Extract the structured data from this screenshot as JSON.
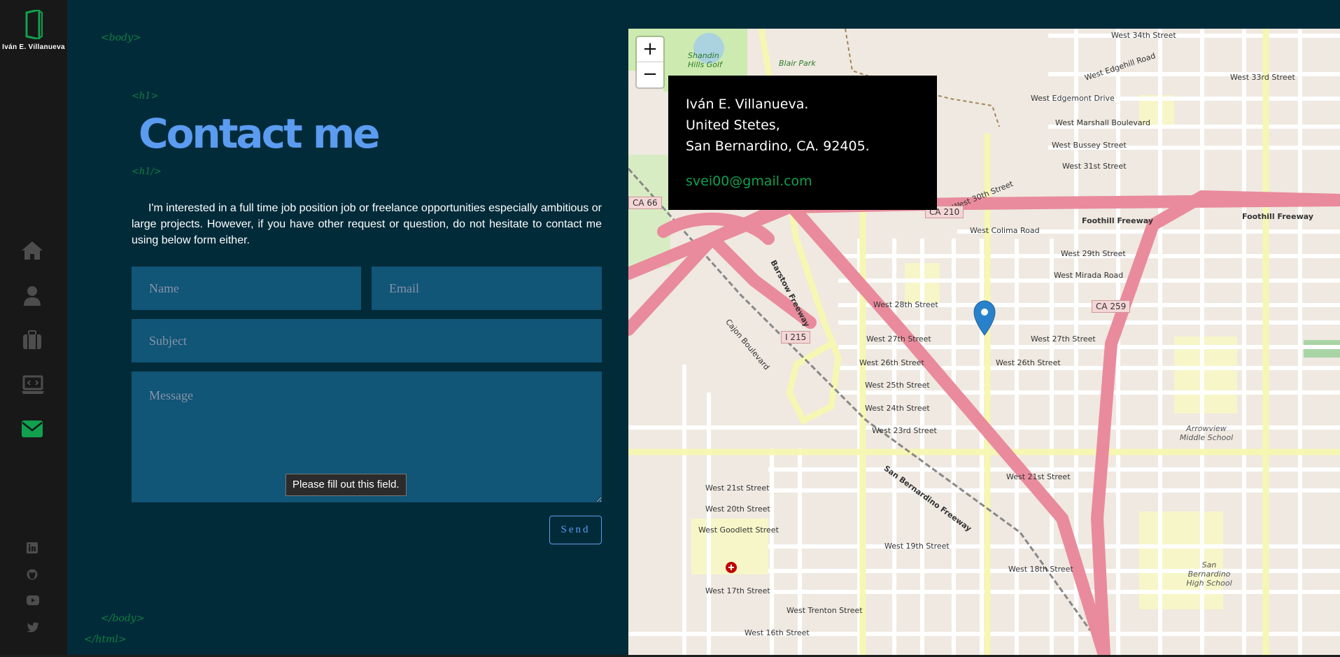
{
  "app": {
    "owner_name": "Iván E. Villanueva"
  },
  "tags": {
    "body_open": "<body>",
    "h1_open": "<h1>",
    "h1_close": "<h1/>",
    "body_close": "</body>",
    "html_close": "</html>"
  },
  "sidebar": {
    "nav_items": [
      {
        "name": "home",
        "icon": "home-icon",
        "active": false
      },
      {
        "name": "about",
        "icon": "user-icon",
        "active": false
      },
      {
        "name": "skills",
        "icon": "briefcase-icon",
        "active": false
      },
      {
        "name": "portfolio",
        "icon": "laptop-code-icon",
        "active": false
      },
      {
        "name": "contact",
        "icon": "envelope-icon",
        "active": true
      }
    ],
    "social": [
      {
        "name": "linkedin",
        "icon": "linkedin-icon"
      },
      {
        "name": "github",
        "icon": "github-icon"
      },
      {
        "name": "youtube",
        "icon": "youtube-icon"
      },
      {
        "name": "twitter",
        "icon": "twitter-icon"
      }
    ],
    "active_color": "#11a04e",
    "icon_color": "#4d4d4e"
  },
  "contact": {
    "title": "Contact me",
    "intro": "I'm interested in a full time job position job or freelance opportunities especially ambitious or large projects. However, if you have other request or question, do not hesitate to contact me using below form either.",
    "form": {
      "name_placeholder": "Name",
      "email_placeholder": "Email",
      "subject_placeholder": "Subject",
      "message_placeholder": "Message",
      "validation_tooltip": "Please fill out this field.",
      "send_label": "Send"
    }
  },
  "map": {
    "zoom_in": "+",
    "zoom_out": "−",
    "info": {
      "line1": "Iván E. Villanueva.",
      "line2": "United Stetes,",
      "line3": "San Bernardino, CA. 92405.",
      "email": "svei00@gmail.com"
    },
    "labels": {
      "foothill": "Foothill Freeway",
      "foothill2": "Foothill Freeway",
      "w27": "West 27th Street",
      "w27b": "West 27th Street",
      "w26": "West 26th Street",
      "w26b": "West 26th Street",
      "w25": "West 25th Street",
      "w24": "West 24th Street",
      "w23": "West 23rd Street",
      "w28": "West 28th Street",
      "w29": "West 29th Street",
      "w30": "West 30th Street",
      "colima": "West Colima Road",
      "mirada": "West Mirada Road",
      "w21": "West 21st Street",
      "w20": "West 20th Street",
      "w19": "West 19th Street",
      "w18": "West 18th Street",
      "w17": "West 17th Street",
      "w16": "West 16th Street",
      "trenton": "West Trenton Street",
      "goodlett": "West Goodlett Street",
      "blair": "Blair Park",
      "shandin": "Shandin Hills Golf",
      "arrowview": "Arrowview Middle School",
      "sbhs": "San Bernardino High School",
      "sbfwy": "San Bernardino Freeway",
      "barstow": "Barstow Freeway",
      "cajon": "Cajon Boulevard",
      "w34": "West 34th Street",
      "w33": "West 33rd Street",
      "edgemont": "West Edgemont Drive",
      "marshall": "West Marshall Boulevard",
      "bussey": "West Bussey Street",
      "w31": "West 31st Street",
      "edgehill": "West Edgehill Road"
    },
    "shields": {
      "ca210": "CA 210",
      "ca259": "CA 259",
      "ca66": "CA 66",
      "i215": "I 215"
    },
    "colors": {
      "background": "#efe9e1",
      "freeway": "#e98b9c",
      "primary": "#f6f7b3",
      "street": "#ffffff",
      "marker": "#2a81cb"
    }
  }
}
